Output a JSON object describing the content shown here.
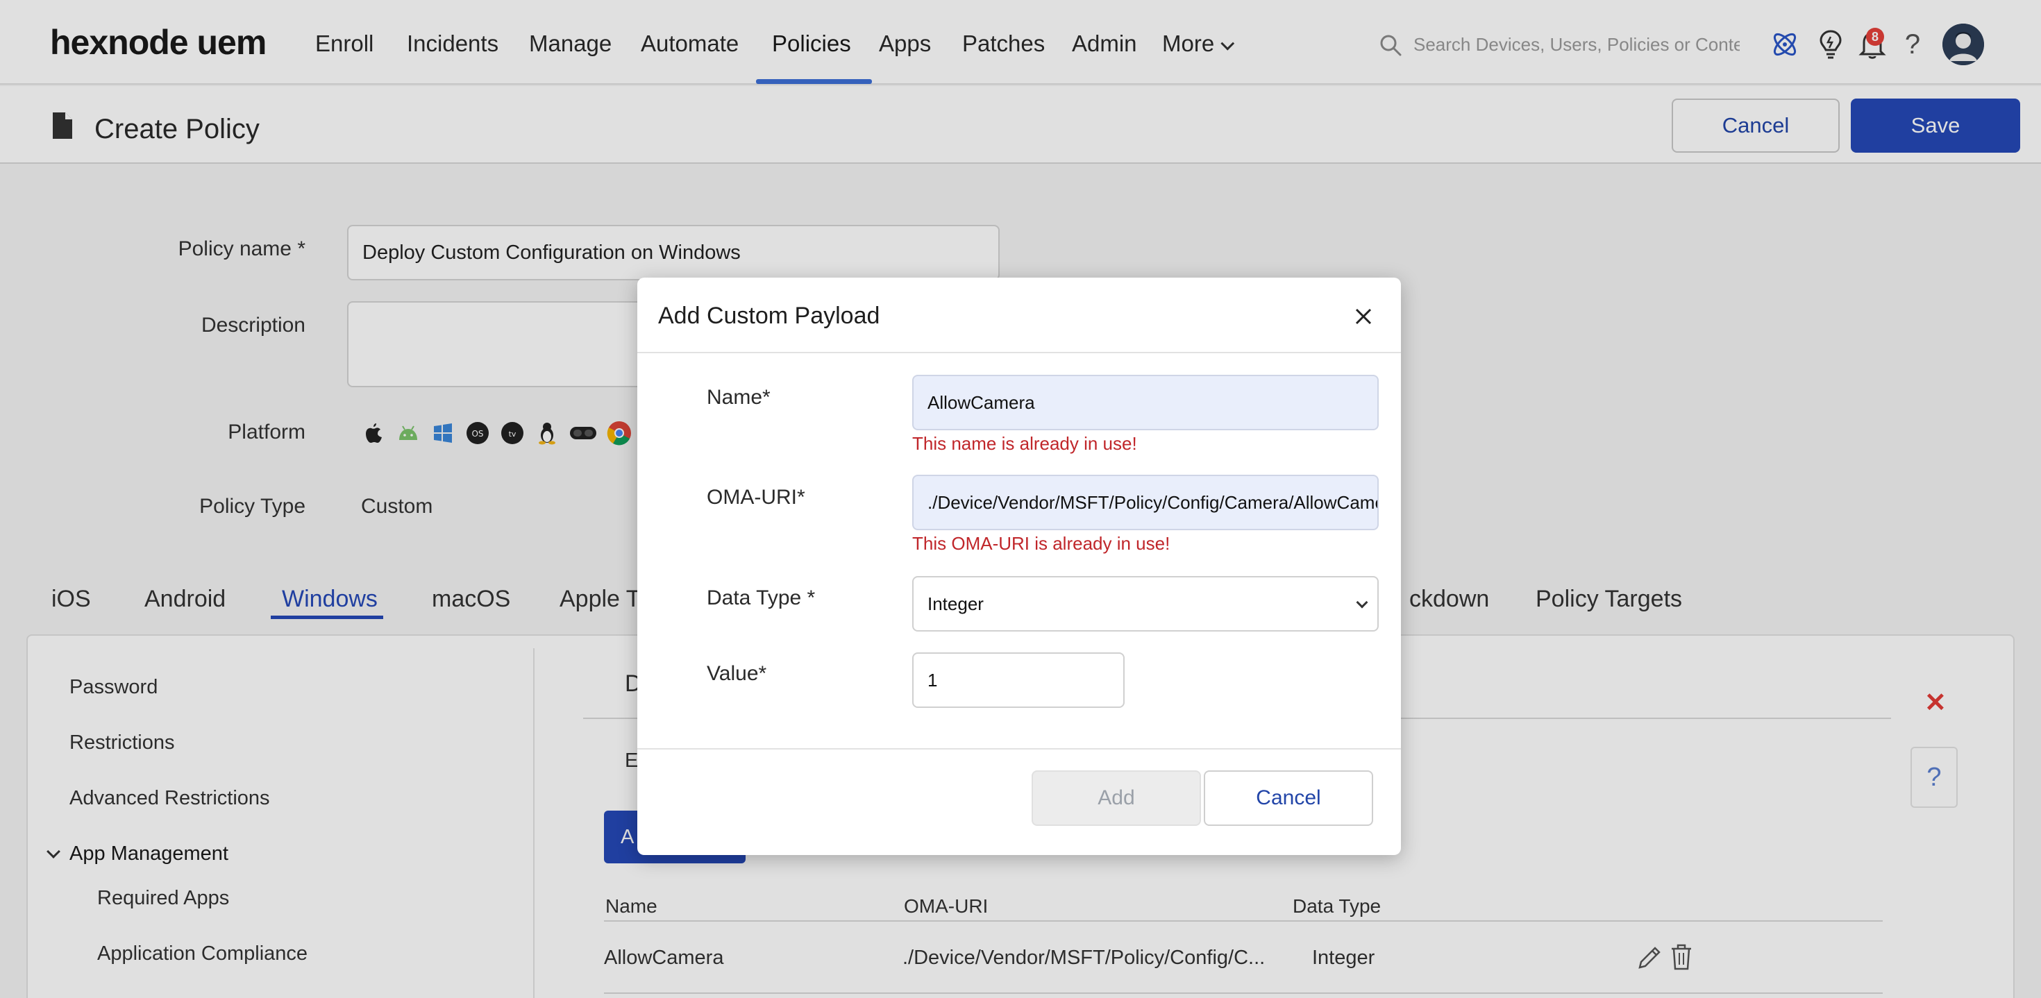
{
  "app": {
    "logo": "hexnode uem"
  },
  "nav": {
    "items": [
      "Enroll",
      "Incidents",
      "Manage",
      "Automate",
      "Policies",
      "Apps",
      "Patches",
      "Admin"
    ],
    "more_label": "More",
    "active": "Policies"
  },
  "search": {
    "placeholder": "Search Devices, Users, Policies or Content"
  },
  "notifications": {
    "count": "8"
  },
  "header": {
    "title": "Create Policy",
    "cancel_label": "Cancel",
    "save_label": "Save"
  },
  "form": {
    "policy_name_label": "Policy name *",
    "policy_name_value": "Deploy Custom Configuration on Windows",
    "description_label": "Description",
    "description_value": "",
    "platform_label": "Platform",
    "platform_icons": [
      "apple-icon",
      "android-icon",
      "windows-icon",
      "fireos-icon",
      "appletv-icon",
      "linux-icon",
      "visionos-icon",
      "chrome-icon"
    ],
    "policy_type_label": "Policy Type",
    "policy_type_value": "Custom"
  },
  "os_tabs": {
    "items": [
      "iOS",
      "Android",
      "Windows",
      "macOS",
      "Apple TV",
      "ckdown",
      "Policy Targets"
    ],
    "active": "Windows"
  },
  "sidebar": {
    "items": [
      "Password",
      "Restrictions",
      "Advanced Restrictions"
    ],
    "group_label": "App Management",
    "sub_items": [
      "Required Apps",
      "Application Compliance"
    ]
  },
  "content": {
    "partial_heading": "D",
    "partial_text": "E",
    "add_button_partial": "A",
    "table": {
      "headers": [
        "Name",
        "OMA-URI",
        "Data Type"
      ],
      "rows": [
        {
          "name": "AllowCamera",
          "oma_uri": "./Device/Vendor/MSFT/Policy/Config/C...",
          "data_type": "Integer"
        }
      ]
    },
    "help_label": "?"
  },
  "modal": {
    "title": "Add Custom Payload",
    "name_label": "Name*",
    "name_value": "AllowCamera",
    "name_error": "This name is already in use!",
    "oma_label": "OMA-URI*",
    "oma_value": "./Device/Vendor/MSFT/Policy/Config/Camera/AllowCamera",
    "oma_error": "This OMA-URI is already in use!",
    "data_type_label": "Data Type *",
    "data_type_value": "Integer",
    "value_label": "Value*",
    "value_value": "1",
    "add_label": "Add",
    "cancel_label": "Cancel"
  },
  "colors": {
    "accent": "#2548b7",
    "error": "#c0262a",
    "badge": "#e5403a"
  }
}
